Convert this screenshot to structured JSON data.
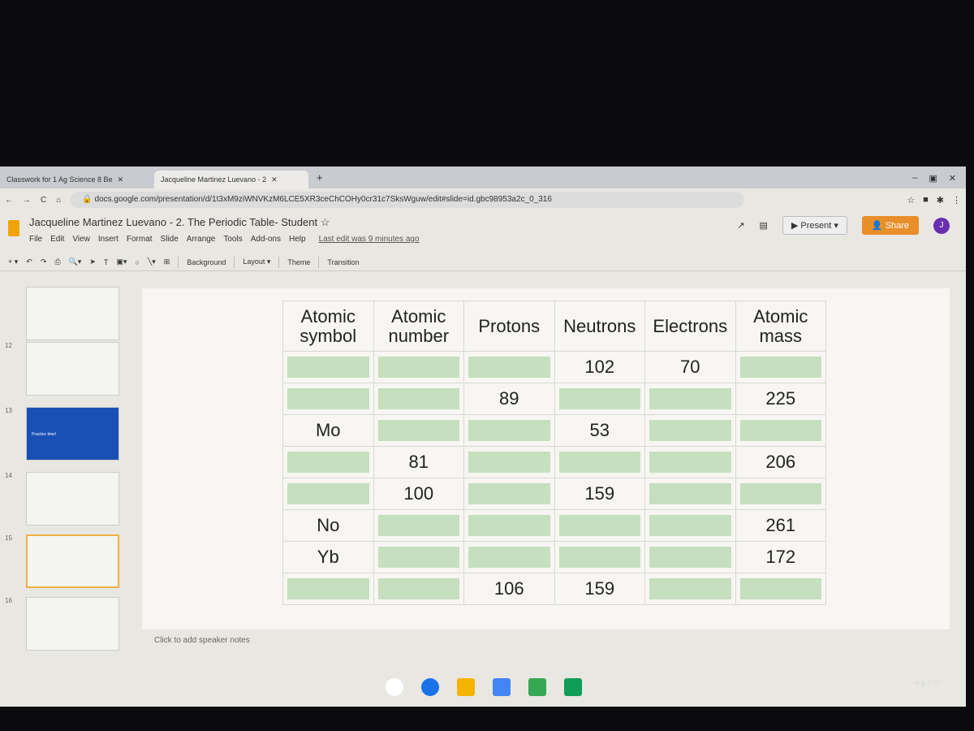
{
  "browser": {
    "tabs": [
      {
        "label": "Classwork for 1 Ag Science 8 Be"
      },
      {
        "label": "Jacqueline Martinez Luevano - 2"
      }
    ],
    "url": "docs.google.com/presentation/d/1t3xM9ziWNVKzM6LCE5XR3ceChCOHy0cr31c7SksWguw/edit#slide=id.gbc98953a2c_0_316"
  },
  "doc": {
    "title": "Jacqueline Martinez Luevano - 2. The Periodic Table- Student",
    "menu": [
      "File",
      "Edit",
      "View",
      "Insert",
      "Format",
      "Slide",
      "Arrange",
      "Tools",
      "Add-ons",
      "Help"
    ],
    "last_edit": "Last edit was 9 minutes ago",
    "present": "Present",
    "share": "Share",
    "avatar": "J"
  },
  "toolbar": {
    "background": "Background",
    "layout": "Layout ▾",
    "theme": "Theme",
    "transition": "Transition"
  },
  "filmstrip": {
    "numbers": [
      "12",
      "13",
      "14",
      "15",
      "16"
    ],
    "practice": "Practice time!"
  },
  "table": {
    "headers": [
      "Atomic symbol",
      "Atomic number",
      "Protons",
      "Neutrons",
      "Electrons",
      "Atomic mass"
    ],
    "rows": [
      [
        "",
        "",
        "",
        "102",
        "70",
        ""
      ],
      [
        "",
        "",
        "89",
        "",
        "",
        "225"
      ],
      [
        "Mo",
        "",
        "",
        "53",
        "",
        ""
      ],
      [
        "",
        "81",
        "",
        "",
        "",
        "206"
      ],
      [
        "",
        "100",
        "",
        "159",
        "",
        ""
      ],
      [
        "No",
        "",
        "",
        "",
        "",
        "261"
      ],
      [
        "Yb",
        "",
        "",
        "",
        "",
        "172"
      ],
      [
        "",
        "",
        "106",
        "159",
        "",
        ""
      ]
    ]
  },
  "notes": "Click to add speaker notes",
  "shelf": {
    "time": "9:57"
  },
  "colors": {
    "cell_fill": "#c6dfbf",
    "share": "#e88f2a",
    "avatar": "#6a2fb0"
  }
}
